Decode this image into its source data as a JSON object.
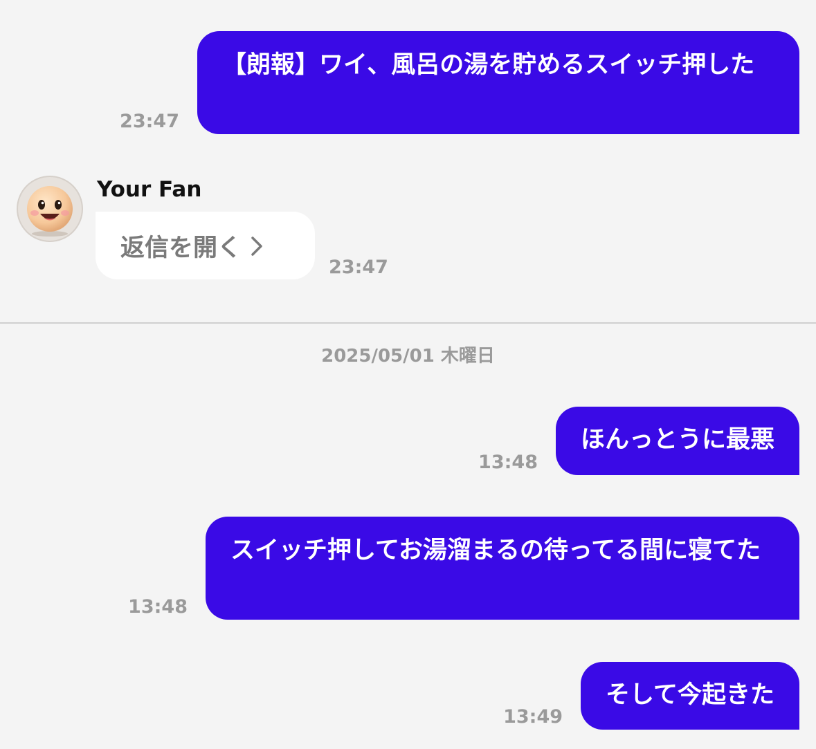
{
  "messages": [
    {
      "text": "【朗報】ワイ、風呂の湯を貯めるスイッチ押した",
      "time": "23:47"
    },
    {
      "text": "ほんっとうに最悪",
      "time": "13:48"
    },
    {
      "text": "スイッチ押してお湯溜まるの待ってる間に寝てた",
      "time": "13:48"
    },
    {
      "text": "そして今起きた",
      "time": "13:49"
    }
  ],
  "reply": {
    "sender": "Your Fan",
    "open_label": "返信を開く",
    "time": "23:47",
    "avatar_icon": "smiley-face-icon",
    "chevron_icon": "chevron-right-icon"
  },
  "date_separator": "2025/05/01 木曜日",
  "colors": {
    "bubble": "#3a0ae6",
    "background": "#f4f4f4",
    "timestamp": "#9a9a9a"
  }
}
